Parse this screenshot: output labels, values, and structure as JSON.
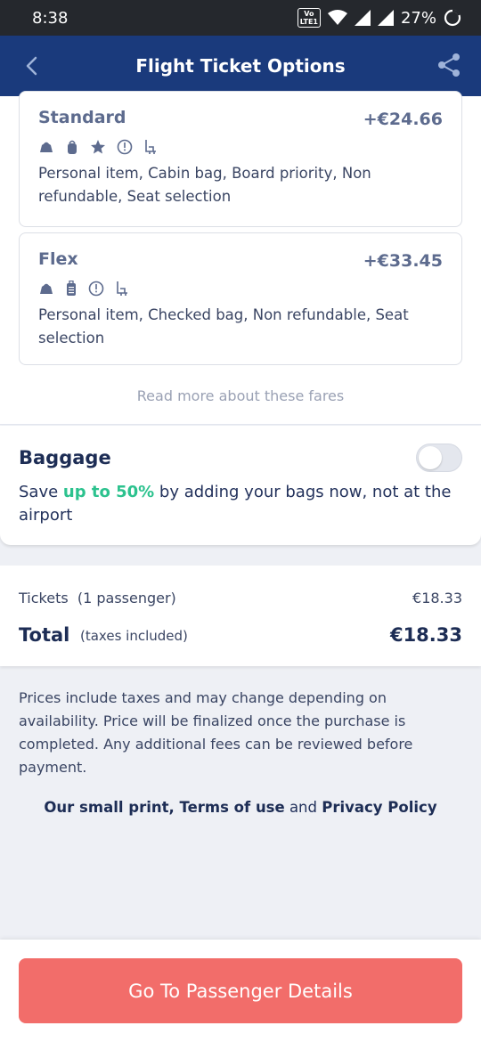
{
  "status_bar": {
    "time": "8:38",
    "volte_top": "Vo",
    "volte_bottom": "LTE1",
    "battery": "27%"
  },
  "app_bar": {
    "title": "Flight Ticket Options",
    "back_icon": "chevron-left-icon",
    "share_icon": "share-icon"
  },
  "fares": [
    {
      "name": "Standard",
      "price": "+€24.66",
      "icons": [
        "personal-item-icon",
        "cabin-bag-icon",
        "star-icon",
        "non-refundable-icon",
        "seat-icon"
      ],
      "description": "Personal item, Cabin bag, Board priority, Non refundable, Seat selection"
    },
    {
      "name": "Flex",
      "price": "+€33.45",
      "icons": [
        "personal-item-icon",
        "checked-bag-icon",
        "non-refundable-icon",
        "seat-icon"
      ],
      "description": "Personal item, Checked bag, Non refundable, Seat selection"
    }
  ],
  "read_more": "Read more about these fares",
  "baggage": {
    "title": "Baggage",
    "text_prefix": "Save ",
    "text_highlight": "up to 50%",
    "text_suffix": " by adding your bags now, not at the airport",
    "toggle_on": false
  },
  "totals": {
    "tickets_label": "Tickets  (1 passenger)",
    "tickets_value": "€18.33",
    "total_label": "Total",
    "total_note": "(taxes included)",
    "total_value": "€18.33"
  },
  "disclaimer": "Prices include taxes and may change depending on availability. Price will be finalized once the purchase is completed. Any additional fees can be reviewed before payment.",
  "small_print": {
    "link1": "Our small print",
    "sep1": ", ",
    "link2": "Terms of use",
    "sep2": " and ",
    "link3": "Privacy Policy"
  },
  "cta": "Go To Passenger Details",
  "colors": {
    "app_bar": "#1a3a7c",
    "accent_green": "#2cc28e",
    "cta": "#f26d6a"
  }
}
